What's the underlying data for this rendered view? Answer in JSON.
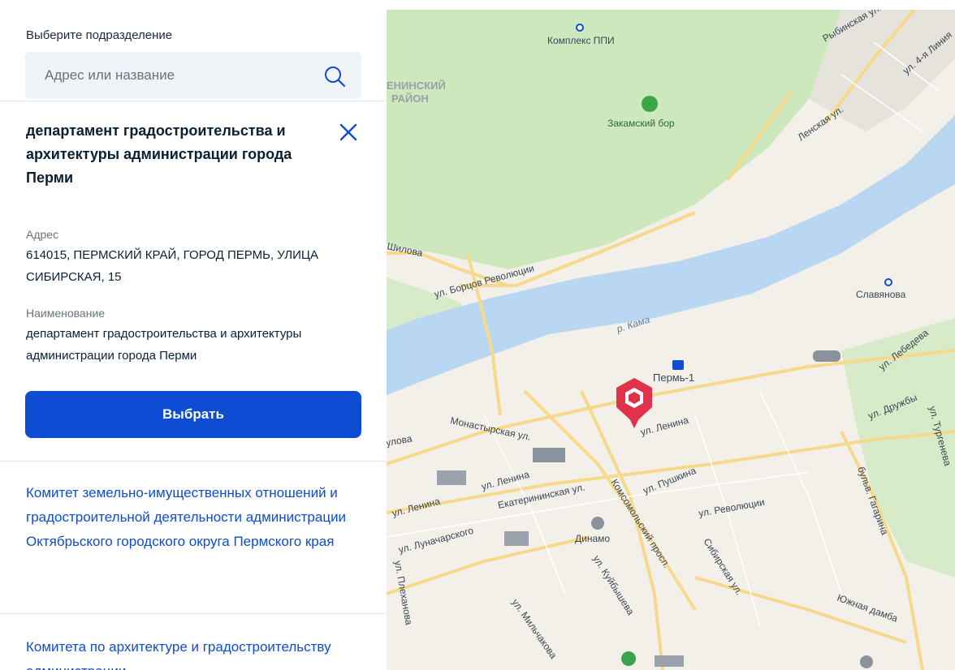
{
  "panel": {
    "select_label": "Выберите подразделение",
    "search": {
      "placeholder": "Адрес или название",
      "value": ""
    },
    "selected": {
      "title": "департамент градостроительства и архитектуры администрации города Перми",
      "address_label": "Адрес",
      "address_value": "614015, ПЕРМСКИЙ КРАЙ, ГОРОД ПЕРМЬ, УЛИЦА СИБИРСКАЯ, 15",
      "name_label": "Наименование",
      "name_value": "департамент градостроительства и архитектуры администрации города Перми",
      "select_button": "Выбрать"
    },
    "other_items": [
      "Комитет земельно-имущественных отношений и градостроительной деятельности администрации Октябрьского городского округа Пермского края",
      "Комитета по архитектуре и градостроительству администрации"
    ]
  },
  "map": {
    "labels": {
      "kompleks": "Комплекс ППИ",
      "district": "ЕНИНСКИЙ",
      "district2": "РАЙОН",
      "zakamsky": "Закамский бор",
      "lenskaya": "Ленская ул.",
      "linia4": "ул. 4-я Линия",
      "rybinskaya": "Рыбинская ул.",
      "shilova": "Шилова",
      "borcov": "ул. Борцов Революции",
      "slavyanova": "Славянова",
      "kama": "р. Кама",
      "perm1": "Пермь-1",
      "lebedeva": "ул. Лебедева",
      "druzhby": "ул. Дружбы",
      "turgeneva": "ул. Тургенева",
      "monastyrskaya": "Монастырская ул.",
      "lenina1": "ул. Ленина",
      "lenina2": "ул. Ленина",
      "lenina3": "ул. Ленина",
      "ulova": "улова",
      "pushkina": "ул. Пушкина",
      "ekaterininskaya": "Екатерининская ул.",
      "revolyucii": "ул. Революции",
      "komsomolsky": "Комсомольский просп.",
      "gagarina": "бульв. Гагарина",
      "lunacharskogo": "ул. Луначарского",
      "dinamo": "Динамо",
      "sibirskaya": "Сибирская ул.",
      "kuybysheva": "ул. Куйбышева",
      "plekhanova": "ул. Плеханова",
      "mylchakova": "ул. Мильчакова",
      "yuzhnaya": "Южная дамба"
    },
    "colors": {
      "water": "#b9d6f2",
      "forest": "#cde8bc",
      "marker": "#e0324a",
      "button": "#0d4cd3"
    }
  }
}
